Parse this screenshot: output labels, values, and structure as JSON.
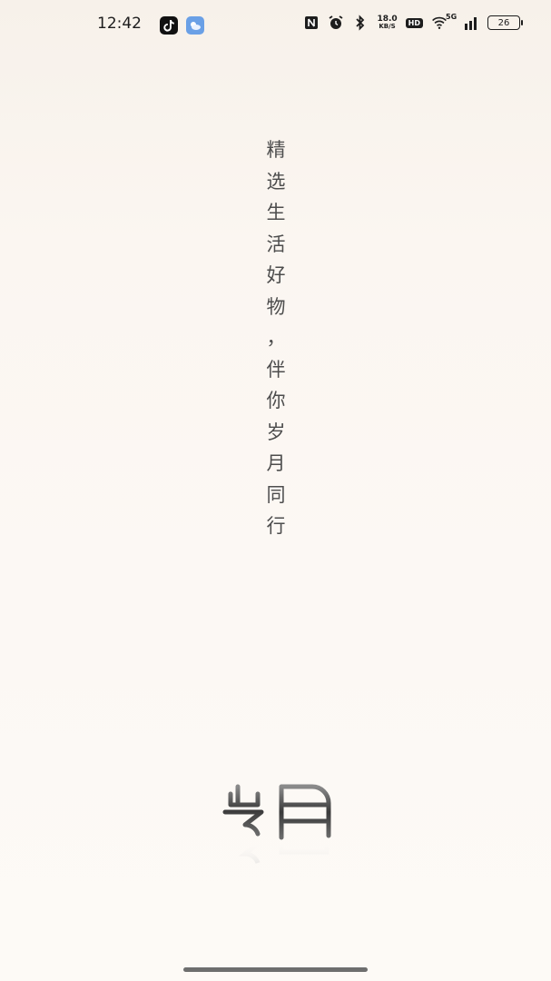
{
  "status_bar": {
    "time": "12:42",
    "notification_icons": [
      "tiktok-icon",
      "weather-icon"
    ],
    "system_icons": [
      "nfc-icon",
      "alarm-icon",
      "bluetooth-icon",
      "network-speed",
      "hd-icon",
      "wifi-icon",
      "signal-5g-icon",
      "battery-icon"
    ],
    "network_speed_value": "18.0",
    "network_speed_unit": "KB/S",
    "hd_label": "HD",
    "signal_label": "5G",
    "battery_level": "26"
  },
  "splash": {
    "slogan_chars": [
      "精",
      "选",
      "生",
      "活",
      "好",
      "物",
      "，",
      "伴",
      "你",
      "岁",
      "月",
      "同",
      "行"
    ],
    "logo_icon": "suiyue-logo-icon",
    "accent_color": "#4d4d4d",
    "background_color": "#fbf6f1"
  }
}
